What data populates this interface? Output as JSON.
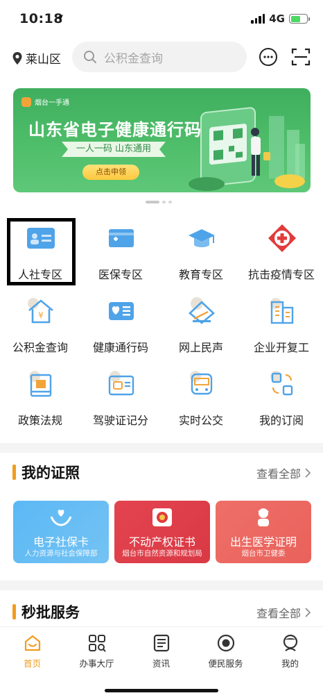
{
  "status_bar": {
    "time": "10:18",
    "network": "4G"
  },
  "header": {
    "city": "莱山区",
    "search_placeholder": "公积金查询"
  },
  "banner": {
    "brand": "烟台一手通",
    "title": "山东省电子健康通行码",
    "ribbon": "一人一码 山东通用",
    "cta": "点击申领"
  },
  "services": [
    {
      "label": "人社专区",
      "icon": "social-security-card-icon"
    },
    {
      "label": "医保专区",
      "icon": "medical-insurance-card-icon"
    },
    {
      "label": "教育专区",
      "icon": "graduation-cap-icon"
    },
    {
      "label": "抗击疫情专区",
      "icon": "red-cross-icon"
    },
    {
      "label": "公积金查询",
      "icon": "house-yuan-icon"
    },
    {
      "label": "健康通行码",
      "icon": "health-code-icon"
    },
    {
      "label": "网上民声",
      "icon": "envelope-voice-icon"
    },
    {
      "label": "企业开复工",
      "icon": "office-building-icon"
    },
    {
      "label": "政策法规",
      "icon": "policy-book-icon"
    },
    {
      "label": "驾驶证记分",
      "icon": "driver-license-icon"
    },
    {
      "label": "实时公交",
      "icon": "bus-icon"
    },
    {
      "label": "我的订阅",
      "icon": "subscription-icon"
    }
  ],
  "licenses": {
    "title": "我的证照",
    "more": "查看全部",
    "cards": [
      {
        "title": "电子社保卡",
        "subtitle": "人力资源与社会保障部",
        "color": "#5fb3f0",
        "icon": "hands-heart-icon"
      },
      {
        "title": "不动产权证书",
        "subtitle": "烟台市自然资源和规划局",
        "color": "#e0454f",
        "icon": "national-emblem-icon"
      },
      {
        "title": "出生医学证明",
        "subtitle": "烟台市卫健委",
        "color": "#ec6c66",
        "icon": "baby-icon"
      }
    ]
  },
  "quick": {
    "title": "秒批服务",
    "more": "查看全部"
  },
  "tabs": [
    {
      "label": "首页",
      "icon": "home-icon",
      "active": true
    },
    {
      "label": "办事大厅",
      "icon": "service-hall-icon",
      "active": false
    },
    {
      "label": "资讯",
      "icon": "news-icon",
      "active": false
    },
    {
      "label": "便民服务",
      "icon": "convenience-icon",
      "active": false
    },
    {
      "label": "我的",
      "icon": "profile-icon",
      "active": false
    }
  ],
  "colors": {
    "accent": "#f29c1f",
    "banner_green": "#4fbe6a"
  }
}
